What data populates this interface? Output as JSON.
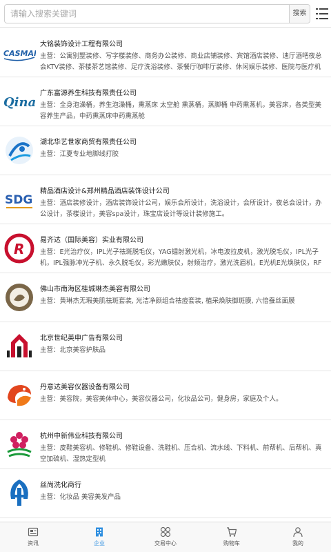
{
  "search": {
    "placeholder": "请输入搜索关键词",
    "button_label": "搜索"
  },
  "companies": [
    {
      "name": "大铭装饰设计工程有限公司",
      "logo_icon": "casman-logo-icon",
      "logo_text": "CASMAN",
      "desc": "主营：公寓别墅装修、写字楼装修、商务办公装修、商业店铺装修、宾馆酒店装修、迪厅酒吧夜总会KTV装修、茶楼茶艺馆装修、足疗洗浴装修、茶餐厅咖啡厅装修、休闲娱乐装修、医院与医疗机构装修、学..."
    },
    {
      "name": "广东富源养生科技有限责任公司",
      "logo_icon": "qinai-logo-icon",
      "logo_text": "Qinai",
      "desc": "主营：全身泡澡桶，养生泡澡桶，熏蒸床 太空舱 熏蒸桶，蒸脚桶 中药熏蒸机，美容床，各类型美容养生产品，中药熏蒸床中药熏蒸舱"
    },
    {
      "name": "湖北华艺世家商贸有限责任公司",
      "logo_icon": "huayi-logo-icon",
      "logo_text": "",
      "desc": "主营：江夏专业地脚线打胶"
    },
    {
      "name": "精品酒店设计&郑州精品酒店装饰设计公司",
      "logo_icon": "sdg-logo-icon",
      "logo_text": "SDG",
      "desc": "主营：酒店装修设计，酒店装饰设计公司，娱乐会所设计，洗浴设计，会所设计，夜总会设计，办公设计，茶楼设计，美容spa设计，珠宝店设计等设计装修施工。"
    },
    {
      "name": "易齐达（国际美容）实业有限公司",
      "logo_icon": "yiqida-logo-icon",
      "logo_text": "R",
      "desc": "主营：E光治疗仪，IPL光子祛斑脱毛仪，YAG镭射激光机，冰电波拉皮机，激光脱毛仪，IPL光子机，IPL强脉冲光子机、永久脱毛仪，彩光嫩肤仪，射频治疗，激光洗眉机，E光机E光焕肤仪，RF射频紧肤，E..."
    },
    {
      "name": "佛山市南海区桂城琳杰美容有限公司",
      "logo_icon": "linjie-logo-icon",
      "logo_text": "",
      "desc": "主营：黄琳杰无瑕美肌祛斑套装, 光洁净颜组合祛痘套装, 植采焕肤御斑膜, 六倍蚕丝面膜"
    },
    {
      "name": "北京世纪英申广告有限公司",
      "logo_icon": "yingshen-logo-icon",
      "logo_text": "",
      "desc": "主营：北京美容护肤品"
    },
    {
      "name": "丹意达美容仪器设备有限公司",
      "logo_icon": "danyida-logo-icon",
      "logo_text": "",
      "desc": "主营：美容院，美容美体中心，美容仪器公司，化妆品公司，健身房，家庭及个人。"
    },
    {
      "name": "杭州中新伟业科技有限公司",
      "logo_icon": "zhongxin-logo-icon",
      "logo_text": "",
      "desc": "主营：皮鞋美容机、修鞋机、修鞋设备、洗鞋机、压合机、流水线、下料机、前帮机、后帮机、真空加硫机、湿热定型机"
    },
    {
      "name": "丝尚洗化商行",
      "logo_icon": "sishang-logo-icon",
      "logo_text": "",
      "desc": "主营：化妆品 美容美发产品"
    }
  ],
  "tabs": [
    {
      "label": "资讯",
      "icon": "news-icon",
      "active": false
    },
    {
      "label": "企业",
      "icon": "building-icon",
      "active": true
    },
    {
      "label": "交易中心",
      "icon": "grid-icon",
      "active": false
    },
    {
      "label": "购物车",
      "icon": "cart-icon",
      "active": false
    },
    {
      "label": "我的",
      "icon": "user-icon",
      "active": false
    }
  ],
  "colors": {
    "accent": "#2f8fe0",
    "border": "#e6e6e6",
    "tab_bg": "#f8f8f8"
  }
}
